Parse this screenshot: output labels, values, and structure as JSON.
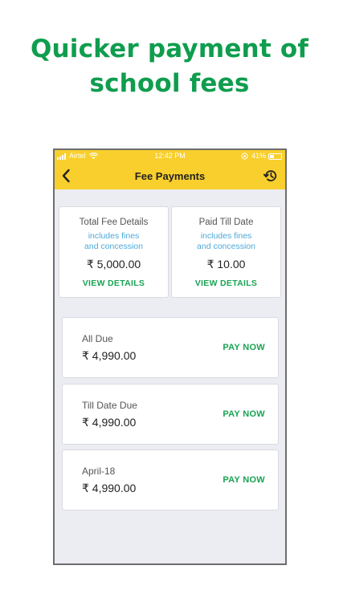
{
  "headline": {
    "line1": "Quicker payment of",
    "line2": "school fees"
  },
  "status_bar": {
    "carrier": "Airtel",
    "time": "12:42 PM",
    "battery": "41%",
    "battery_level": 0.41
  },
  "nav": {
    "title": "Fee Payments",
    "back_icon": "chevron-left-icon",
    "history_icon": "history-icon"
  },
  "summary": [
    {
      "title": "Total Fee Details",
      "note_line1": "includes fines",
      "note_line2": "and concession",
      "amount": "₹ 5,000.00",
      "link": "VIEW DETAILS"
    },
    {
      "title": "Paid Till Date",
      "note_line1": "includes fines",
      "note_line2": "and concession",
      "amount": "₹ 10.00",
      "link": "VIEW DETAILS"
    }
  ],
  "dues": [
    {
      "label": "All Due",
      "amount": "₹ 4,990.00",
      "action": "PAY NOW"
    },
    {
      "label": "Till Date Due",
      "amount": "₹ 4,990.00",
      "action": "PAY NOW"
    },
    {
      "label": "April-18",
      "amount": "₹ 4,990.00",
      "action": "PAY NOW"
    }
  ],
  "colors": {
    "accent_yellow": "#f8cf2c",
    "headline_green": "#0f9d4e",
    "action_green": "#18a352",
    "note_blue": "#4ea9d8"
  }
}
